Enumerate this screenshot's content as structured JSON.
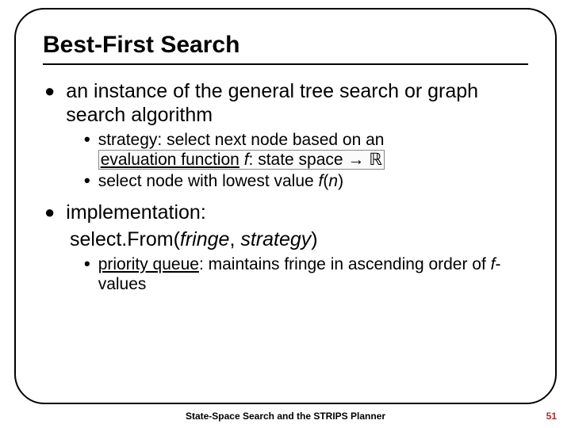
{
  "title": "Best-First Search",
  "bullets": [
    {
      "text": "an instance of the general tree search or graph search algorithm",
      "sub": [
        {
          "pre": "strategy: select next node based on an ",
          "hl_pre_under": "evaluation function",
          "hl_mid": " ",
          "hl_mid_ital": "f",
          "hl_post": ": state space → ℝ"
        },
        {
          "pre": "select node with lowest value ",
          "ital1": "f",
          "mid": "(",
          "ital2": "n",
          "post": ")"
        }
      ]
    },
    {
      "text": "implementation:",
      "code_line": {
        "a": "select.From(",
        "b": "fringe",
        "c": ", ",
        "d": "strategy",
        "e": ")"
      },
      "sub": [
        {
          "under": "priority queue",
          "rest_a": ": maintains fringe in ascending order of ",
          "ital": "f",
          "rest_b": "-values"
        }
      ]
    }
  ],
  "footer": "State-Space Search and the STRIPS Planner",
  "page": "51"
}
